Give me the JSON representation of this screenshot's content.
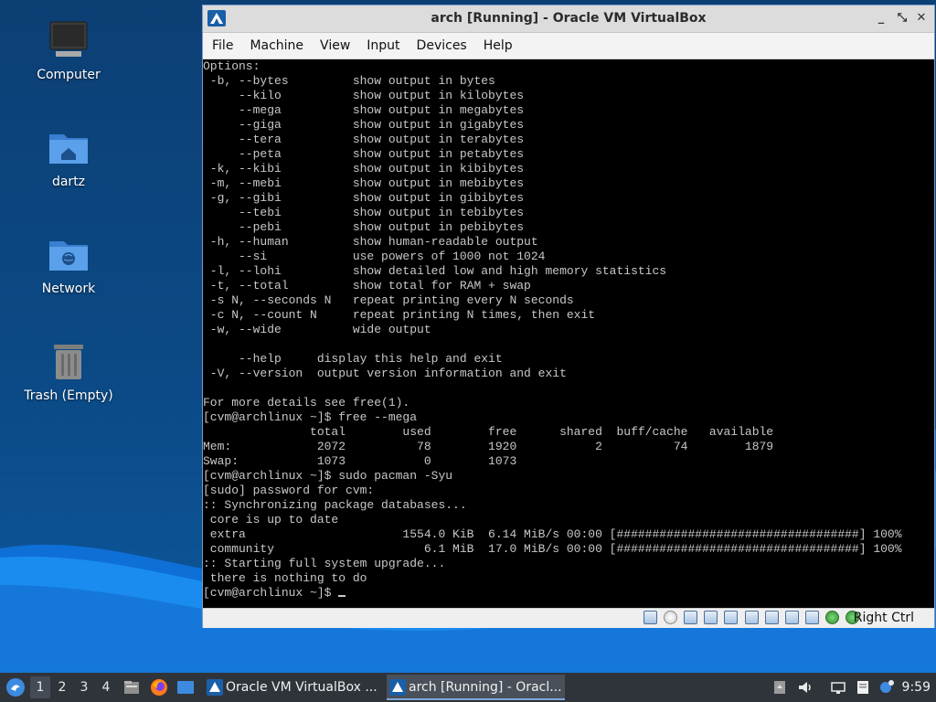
{
  "desktop": {
    "icons": [
      {
        "label": "Computer",
        "icon": "computer-icon"
      },
      {
        "label": "dartz",
        "icon": "home-folder-icon"
      },
      {
        "label": "Network",
        "icon": "network-folder-icon"
      },
      {
        "label": "Trash (Empty)",
        "icon": "trash-icon"
      }
    ]
  },
  "window": {
    "title": "arch [Running] - Oracle VM VirtualBox",
    "controls": {
      "minimize": "_",
      "restore": "⤡",
      "close": "✕"
    },
    "menu": [
      "File",
      "Machine",
      "View",
      "Input",
      "Devices",
      "Help"
    ],
    "host_key": "Right Ctrl",
    "status_icons": [
      "hard-disk-icon",
      "optical-drive-icon",
      "audio-icon",
      "network-icon",
      "usb-icon",
      "shared-folders-icon",
      "display-icon",
      "video-capture-icon",
      "cpu-icon",
      "guest-additions-icon",
      "mouse-integration-icon"
    ]
  },
  "terminal": {
    "lines": [
      "Options:",
      " -b, --bytes         show output in bytes",
      "     --kilo          show output in kilobytes",
      "     --mega          show output in megabytes",
      "     --giga          show output in gigabytes",
      "     --tera          show output in terabytes",
      "     --peta          show output in petabytes",
      " -k, --kibi          show output in kibibytes",
      " -m, --mebi          show output in mebibytes",
      " -g, --gibi          show output in gibibytes",
      "     --tebi          show output in tebibytes",
      "     --pebi          show output in pebibytes",
      " -h, --human         show human-readable output",
      "     --si            use powers of 1000 not 1024",
      " -l, --lohi          show detailed low and high memory statistics",
      " -t, --total         show total for RAM + swap",
      " -s N, --seconds N   repeat printing every N seconds",
      " -c N, --count N     repeat printing N times, then exit",
      " -w, --wide          wide output",
      "",
      "     --help     display this help and exit",
      " -V, --version  output version information and exit",
      "",
      "For more details see free(1).",
      "[cvm@archlinux ~]$ free --mega",
      "               total        used        free      shared  buff/cache   available",
      "Mem:            2072          78        1920           2          74        1879",
      "Swap:           1073           0        1073",
      "[cvm@archlinux ~]$ sudo pacman -Syu",
      "[sudo] password for cvm:",
      ":: Synchronizing package databases...",
      " core is up to date",
      " extra                      1554.0 KiB  6.14 MiB/s 00:00 [##################################] 100%",
      " community                     6.1 MiB  17.0 MiB/s 00:00 [##################################] 100%",
      ":: Starting full system upgrade...",
      " there is nothing to do",
      "[cvm@archlinux ~]$ "
    ]
  },
  "taskbar": {
    "workspaces": [
      "1",
      "2",
      "3",
      "4"
    ],
    "active_workspace": "1",
    "launchers": [
      "file-manager-icon",
      "firefox-icon",
      "show-desktop-icon"
    ],
    "tasks": [
      {
        "label": "Oracle VM VirtualBox ...",
        "icon": "virtualbox-icon",
        "active": false
      },
      {
        "label": "arch [Running] - Oracl...",
        "icon": "virtualbox-vm-icon",
        "active": true
      }
    ],
    "tray": [
      "clipboard-icon",
      "volume-icon",
      "network-icon",
      "notes-icon",
      "update-notifier-icon"
    ],
    "clock": "9:59"
  },
  "colors": {
    "desktop_bg": "#0b4a86",
    "wave_light": "#1e90ff",
    "taskbar_bg": "#2f343b",
    "terminal_bg": "#000000",
    "terminal_fg": "#c8c8c8",
    "window_border": "#7a9cc6"
  }
}
